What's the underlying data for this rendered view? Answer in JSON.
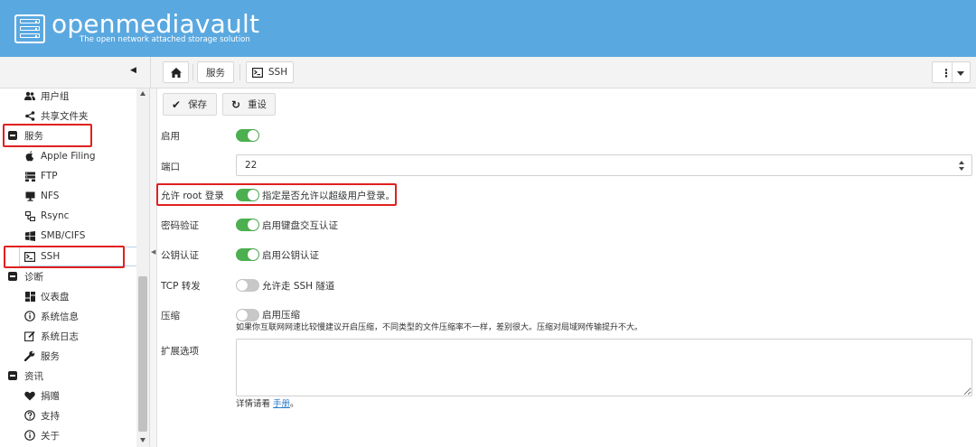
{
  "header": {
    "brand": "openmediavault",
    "tagline": "The open network attached storage solution",
    "bg_color": "#5aa8e0",
    "logo_icon": "server-rack-icon"
  },
  "breadcrumb": {
    "home_icon": "home-icon",
    "services_label": "服务",
    "ssh_label": "SSH",
    "ssh_icon": "terminal-icon"
  },
  "toolbar": {
    "more_icon": "kebab-icon",
    "dropdown_icon": "caret-down-icon"
  },
  "sidebar": {
    "items": [
      {
        "label": "用户组",
        "icon": "users-icon"
      },
      {
        "label": "共享文件夹",
        "icon": "share-icon"
      },
      {
        "label": "服务",
        "icon": "minus-square-icon",
        "group": true
      },
      {
        "label": "Apple Filing",
        "icon": "apple-icon"
      },
      {
        "label": "FTP",
        "icon": "ftp-icon"
      },
      {
        "label": "NFS",
        "icon": "desktop-icon"
      },
      {
        "label": "Rsync",
        "icon": "sitemap-icon"
      },
      {
        "label": "SMB/CIFS",
        "icon": "windows-icon"
      },
      {
        "label": "SSH",
        "icon": "terminal-icon",
        "selected": true
      },
      {
        "label": "诊断",
        "icon": "minus-square-icon",
        "group": true
      },
      {
        "label": "仪表盘",
        "icon": "dashboard-icon"
      },
      {
        "label": "系统信息",
        "icon": "info-icon"
      },
      {
        "label": "系统日志",
        "icon": "edit-icon"
      },
      {
        "label": "服务",
        "icon": "wrench-icon"
      },
      {
        "label": "资讯",
        "icon": "minus-square-icon",
        "group": true
      },
      {
        "label": "捐赠",
        "icon": "heart-icon"
      },
      {
        "label": "支持",
        "icon": "question-icon"
      },
      {
        "label": "关于",
        "icon": "info-icon"
      }
    ]
  },
  "actions": {
    "save_label": "保存",
    "reset_label": "重设"
  },
  "form": {
    "enable_label": "启用",
    "enable_on": true,
    "port_label": "端口",
    "port_value": "22",
    "root_label": "允许 root 登录",
    "root_on": true,
    "root_text": "指定是否允许以超级用户登录。",
    "pwd_label": "密码验证",
    "pwd_on": true,
    "pwd_text": "启用键盘交互认证",
    "pubkey_label": "公钥认证",
    "pubkey_on": true,
    "pubkey_text": "启用公钥认证",
    "tcp_label": "TCP 转发",
    "tcp_on": false,
    "tcp_text": "允许走 SSH 隧道",
    "compress_label": "压缩",
    "compress_on": false,
    "compress_text": "启用压缩",
    "compress_hint": "如果你互联网网速比较慢建议开启压缩，不同类型的文件压缩率不一样，差别很大。压缩对局域网传输提升不大。",
    "ext_label": "扩展选项",
    "ext_value": "",
    "doc_prefix": "详情请看 ",
    "doc_link": "手册",
    "doc_suffix": "。"
  },
  "colors": {
    "toggle_on": "#4caf50",
    "toggle_off": "#c8c8c8",
    "annotation_red": "#e02020",
    "link": "#2a7ec8"
  }
}
